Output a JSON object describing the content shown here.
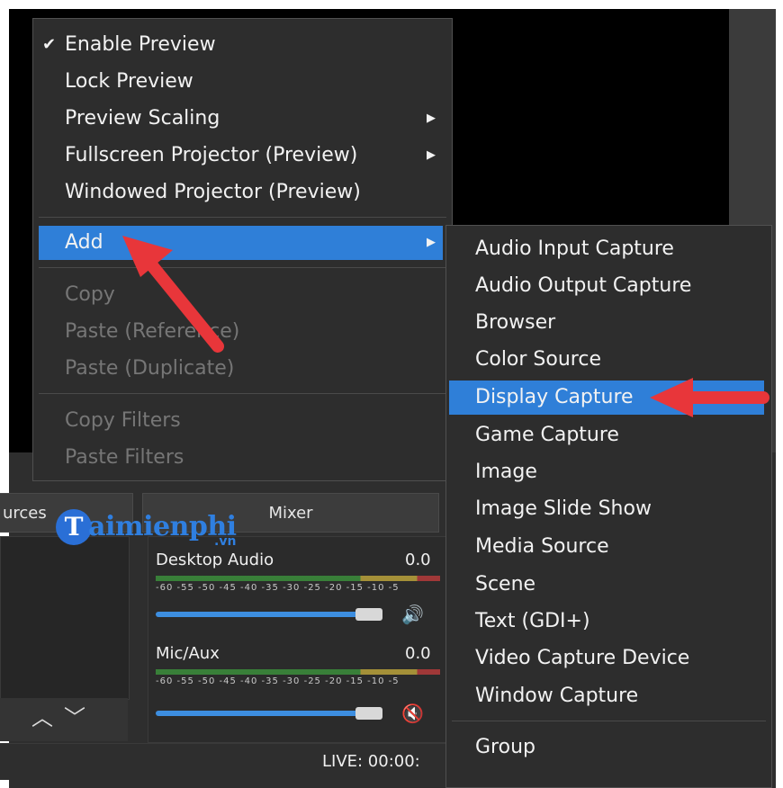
{
  "context_menu": {
    "items": [
      {
        "label": "Enable Preview",
        "checked": true
      },
      {
        "label": "Lock Preview"
      },
      {
        "label": "Preview Scaling",
        "submenu": true
      },
      {
        "label": "Fullscreen Projector (Preview)",
        "submenu": true
      },
      {
        "label": "Windowed Projector (Preview)"
      },
      {
        "label": "Add",
        "submenu": true,
        "highlighted": true
      },
      {
        "label": "Copy",
        "disabled": true
      },
      {
        "label": "Paste (Reference)",
        "disabled": true
      },
      {
        "label": "Paste (Duplicate)",
        "disabled": true
      },
      {
        "label": "Copy Filters",
        "disabled": true
      },
      {
        "label": "Paste Filters",
        "disabled": true
      }
    ]
  },
  "add_submenu": {
    "items": [
      {
        "label": "Audio Input Capture"
      },
      {
        "label": "Audio Output Capture"
      },
      {
        "label": "Browser"
      },
      {
        "label": "Color Source"
      },
      {
        "label": "Display Capture",
        "highlighted": true
      },
      {
        "label": "Game Capture"
      },
      {
        "label": "Image"
      },
      {
        "label": "Image Slide Show"
      },
      {
        "label": "Media Source"
      },
      {
        "label": "Scene"
      },
      {
        "label": "Text (GDI+)"
      },
      {
        "label": "Video Capture Device"
      },
      {
        "label": "Window Capture"
      },
      {
        "label": "Group"
      }
    ]
  },
  "docks": {
    "sources_title": "urces",
    "mixer_title": "Mixer"
  },
  "mixer": {
    "channels": [
      {
        "name": "Desktop Audio",
        "db": "0.0",
        "volume": 0.85,
        "muted": false
      },
      {
        "name": "Mic/Aux",
        "db": "0.0",
        "volume": 0.85,
        "muted": true
      }
    ],
    "ticks": "-60 -55 -50 -45 -40 -35 -30 -25 -20 -15 -10 -5"
  },
  "status": {
    "live": "LIVE: 00:00:"
  },
  "source_controls": {
    "up": "︿",
    "down": "﹀"
  },
  "watermark": {
    "initial": "T",
    "text": "aimienphi",
    "suffix": ".vn"
  },
  "colors": {
    "highlight": "#2f7fd8",
    "menu_bg": "#2d2d2d",
    "annotation_arrow": "#e8363a",
    "watermark": "#2f7fe0"
  },
  "icons": {
    "check": "checkmark-icon",
    "submenu": "triangle-right-icon",
    "speaker": "speaker-icon",
    "muted": "speaker-muted-icon"
  }
}
